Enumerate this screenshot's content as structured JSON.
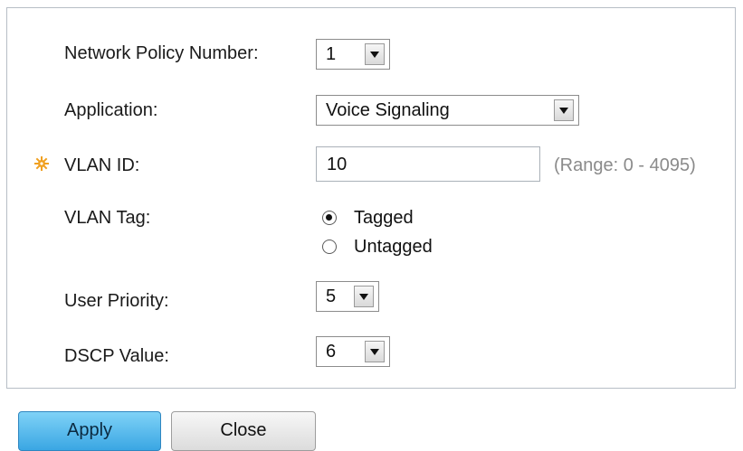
{
  "form": {
    "network_policy_number": {
      "label": "Network Policy Number:",
      "value": "1"
    },
    "application": {
      "label": "Application:",
      "value": "Voice Signaling"
    },
    "vlan_id": {
      "label": "VLAN ID:",
      "value": "10",
      "range_hint": "(Range: 0 - 4095)"
    },
    "vlan_tag": {
      "label": "VLAN Tag:",
      "options": [
        {
          "label": "Tagged",
          "selected": true
        },
        {
          "label": "Untagged",
          "selected": false
        }
      ]
    },
    "user_priority": {
      "label": "User Priority:",
      "value": "5"
    },
    "dscp_value": {
      "label": "DSCP Value:",
      "value": "6"
    }
  },
  "buttons": {
    "apply": "Apply",
    "close": "Close"
  },
  "colors": {
    "required_icon": "#f0a020",
    "apply_button": "#3aa6e3",
    "panel_border": "#b7bec6"
  },
  "icons": {
    "required": "gear-asterisk-icon",
    "dropdown": "chevron-down-icon"
  }
}
